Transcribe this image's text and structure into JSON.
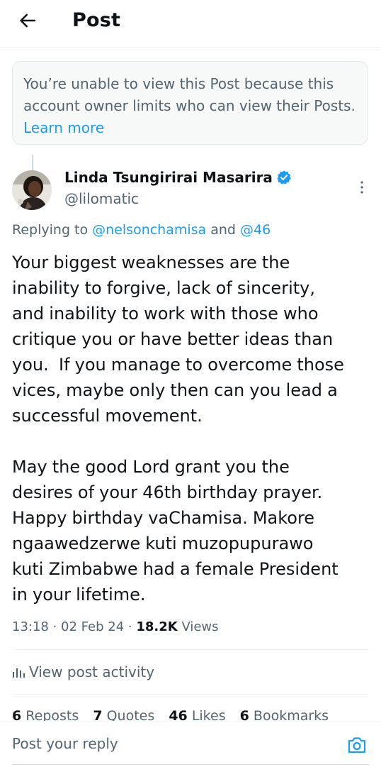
{
  "header": {
    "title": "Post",
    "back_icon": "arrow-left-icon"
  },
  "notice": {
    "text": "You’re unable to view this Post because this account owner limits who can view their Posts. ",
    "link": "Learn more"
  },
  "post": {
    "author": {
      "name": "Linda Tsungirirai Masarira",
      "handle": "@lilomatic",
      "verified": true,
      "verified_color": "#1d9bf0"
    },
    "replying": {
      "prefix": "Replying to ",
      "mention1": "@nelsonchamisa",
      "and": " and ",
      "mention2": "@46"
    },
    "text": "Your biggest weaknesses are the\ninability to forgive, lack of sincerity,\nand inability to work with those who\ncritique you or have better ideas than\nyou.  If you manage to overcome those\nvices, maybe only then can you lead a\nsuccessful movement.\n\nMay the good Lord grant you the\ndesires of your 46th birthday prayer.\nHappy birthday vaChamisa. Makore\nngaawedzerwe kuti muzopupurawo\nkuti Zimbabwe had a female President\nin your lifetime.",
    "time": "13:18",
    "date": "02 Feb 24",
    "views": "18.2K",
    "views_label": "Views",
    "sep": " · "
  },
  "activity": {
    "label": "View post activity"
  },
  "stats": {
    "reposts": {
      "count": "6",
      "label": "Reposts"
    },
    "quotes": {
      "count": "7",
      "label": "Quotes"
    },
    "likes": {
      "count": "46",
      "label": "Likes"
    },
    "bookmarks": {
      "count": "6",
      "label": "Bookmarks"
    }
  },
  "reply": {
    "placeholder": "Post your reply"
  },
  "colors": {
    "accent": "#1d9bf0",
    "secondary_text": "#536471",
    "text": "#0f1419"
  }
}
